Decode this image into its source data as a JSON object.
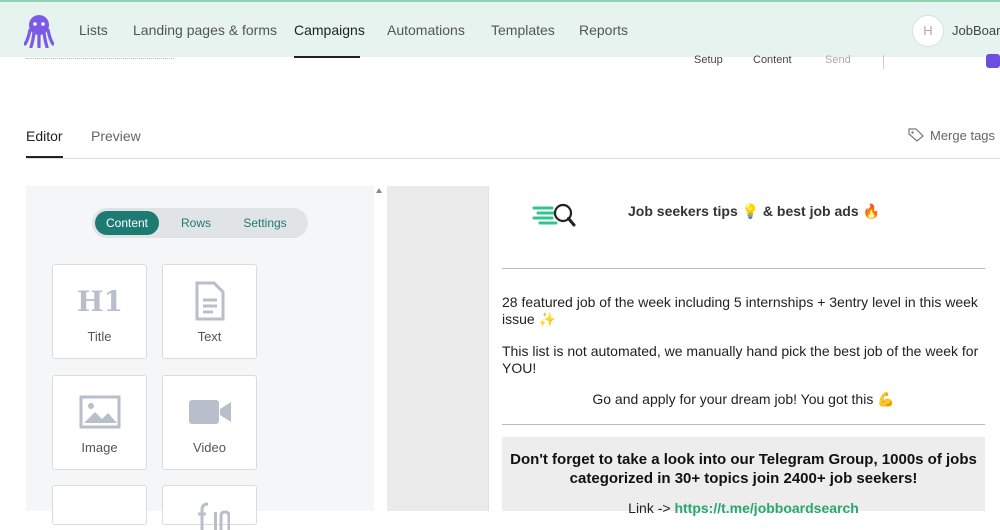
{
  "nav": {
    "items": [
      "Lists",
      "Landing pages & forms",
      "Campaigns",
      "Automations",
      "Templates",
      "Reports"
    ],
    "active": "Campaigns",
    "user_initial": "H",
    "user_name": "JobBoard"
  },
  "steps": [
    "Setup",
    "Content",
    "Send"
  ],
  "tabs": {
    "editor": "Editor",
    "preview": "Preview"
  },
  "merge_tags": "Merge tags",
  "panel": {
    "toggle": [
      "Content",
      "Rows",
      "Settings"
    ],
    "blocks": [
      {
        "label": "Title",
        "icon": "h1-icon"
      },
      {
        "label": "Text",
        "icon": "document-icon"
      },
      {
        "label": "Image",
        "icon": "image-icon"
      },
      {
        "label": "Video",
        "icon": "video-icon"
      }
    ]
  },
  "email": {
    "title": "Job seekers tips 💡 & best job ads 🔥",
    "para1": "28 featured job of the week including 5 internships + 3entry level in this week issue ✨",
    "para2": "This list is not automated, we manually hand pick the best job of the week for YOU!",
    "para3": "Go and apply for your dream job! You got this 💪",
    "cta": "Don't forget to take a look into our Telegram Group, 1000s of jobs categorized in 30+ topics join 2400+ job seekers!",
    "link_prefix": "Link -> ",
    "link": "https://t.me/jobboardsearch"
  }
}
